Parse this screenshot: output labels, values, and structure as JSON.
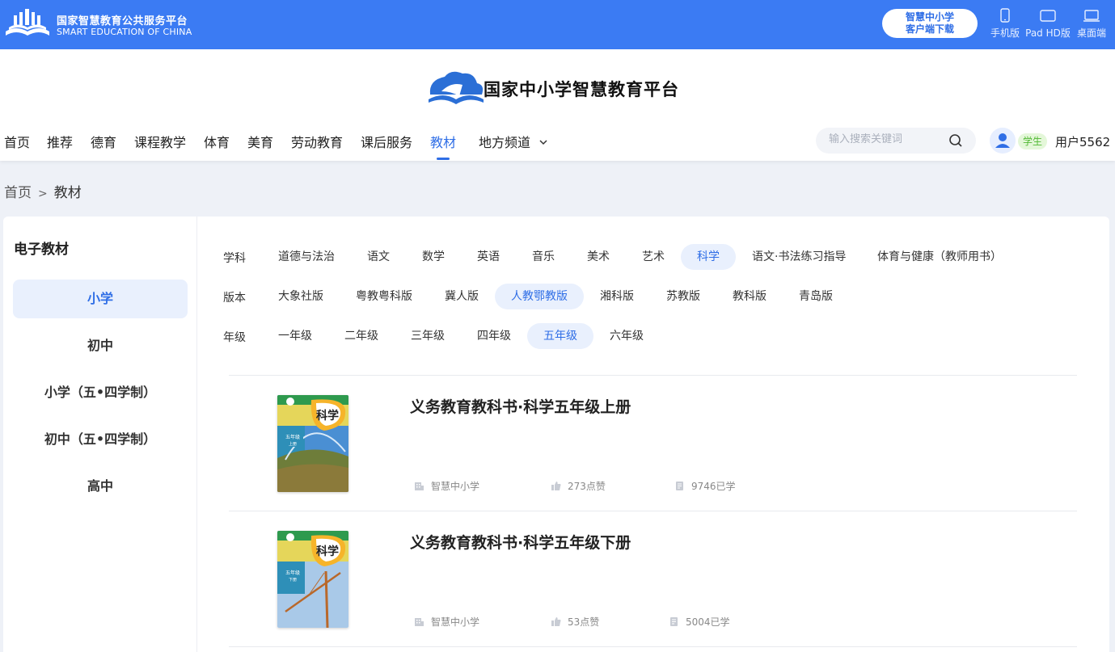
{
  "topbar": {
    "brand_cn": "国家智慧教育公共服务平台",
    "brand_en": "SMART EDUCATION OF CHINA",
    "download_line1": "智慧中小学",
    "download_line2": "客户端下载",
    "devices": [
      {
        "label": "手机版",
        "icon": "phone-icon"
      },
      {
        "label": "Pad HD版",
        "icon": "tablet-icon"
      },
      {
        "label": "桌面端",
        "icon": "laptop-icon"
      }
    ]
  },
  "header": {
    "site_title": "国家中小学智慧教育平台",
    "nav": [
      {
        "label": "首页"
      },
      {
        "label": "推荐"
      },
      {
        "label": "德育"
      },
      {
        "label": "课程教学"
      },
      {
        "label": "体育"
      },
      {
        "label": "美育"
      },
      {
        "label": "劳动教育"
      },
      {
        "label": "课后服务"
      },
      {
        "label": "教材",
        "active": true
      },
      {
        "label": "地方频道"
      }
    ],
    "search_placeholder": "输入搜索关键词",
    "role_badge": "学生",
    "username": "用户5562"
  },
  "breadcrumb": {
    "home": "首页",
    "separator": ">",
    "current": "教材"
  },
  "sidebar": {
    "title": "电子教材",
    "items": [
      {
        "label": "小学",
        "active": true
      },
      {
        "label": "初中"
      },
      {
        "label": "小学（五•四学制）"
      },
      {
        "label": "初中（五•四学制）"
      },
      {
        "label": "高中"
      }
    ]
  },
  "filters": {
    "subject": {
      "label": "学科",
      "options": [
        "道德与法治",
        "语文",
        "数学",
        "英语",
        "音乐",
        "美术",
        "艺术",
        "科学",
        "语文·书法练习指导",
        "体育与健康（教师用书）"
      ],
      "selected": "科学"
    },
    "edition": {
      "label": "版本",
      "options": [
        "大象社版",
        "粤教粤科版",
        "冀人版",
        "人教鄂教版",
        "湘科版",
        "苏教版",
        "教科版",
        "青岛版"
      ],
      "selected": "人教鄂教版"
    },
    "grade": {
      "label": "年级",
      "options": [
        "一年级",
        "二年级",
        "三年级",
        "四年级",
        "五年级",
        "六年级"
      ],
      "selected": "五年级"
    }
  },
  "books": [
    {
      "title": "义务教育教科书·科学五年级上册",
      "publisher": "智慧中小学",
      "likes": "273点赞",
      "learners": "9746已学",
      "cover_subject": "科学",
      "cover_grade": "五年级",
      "cover_volume": "上册"
    },
    {
      "title": "义务教育教科书·科学五年级下册",
      "publisher": "智慧中小学",
      "likes": "53点赞",
      "learners": "5004已学",
      "cover_subject": "科学",
      "cover_grade": "五年级",
      "cover_volume": "下册"
    }
  ],
  "colors": {
    "topbar_bg": "#3b7bf3",
    "accent": "#2f6ee6",
    "active_bg": "#e9f0fd",
    "student_badge_bg": "#e4f7d9",
    "student_badge_text": "#52b935"
  }
}
